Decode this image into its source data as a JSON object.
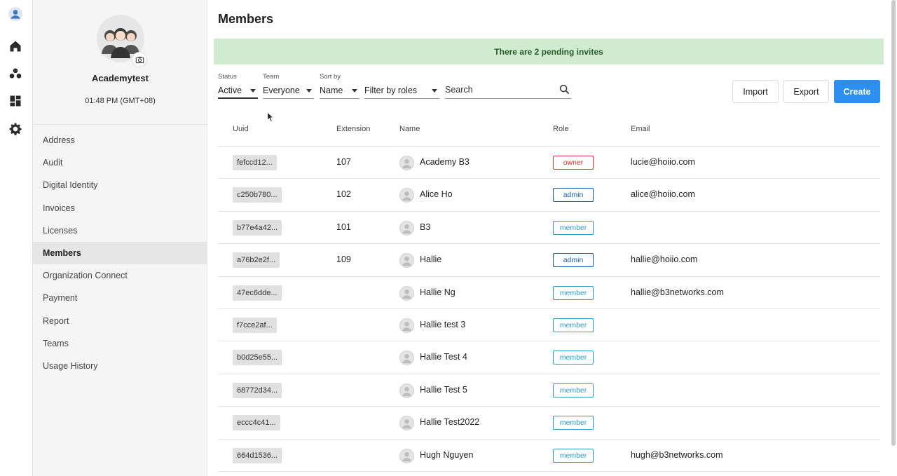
{
  "rail": {
    "icons": [
      "user-avatar-icon",
      "home-icon",
      "team-icon",
      "dashboard-icon",
      "gear-icon"
    ]
  },
  "org": {
    "name": "Academytest",
    "time": "01:48 PM (GMT+08)"
  },
  "sidebar": {
    "items": [
      {
        "label": "Address"
      },
      {
        "label": "Audit"
      },
      {
        "label": "Digital Identity"
      },
      {
        "label": "Invoices"
      },
      {
        "label": "Licenses"
      },
      {
        "label": "Members",
        "active": true
      },
      {
        "label": "Organization Connect"
      },
      {
        "label": "Payment"
      },
      {
        "label": "Report"
      },
      {
        "label": "Teams"
      },
      {
        "label": "Usage History"
      }
    ]
  },
  "page": {
    "title": "Members",
    "banner": "There are 2 pending invites"
  },
  "filters": {
    "status": {
      "label": "Status",
      "value": "Active"
    },
    "team": {
      "label": "Team",
      "value": "Everyone"
    },
    "sort": {
      "label": "Sort by",
      "value": "Name"
    },
    "roles": {
      "value": "Filter by roles"
    },
    "search": {
      "placeholder": "Search"
    }
  },
  "actions": {
    "import": "Import",
    "export": "Export",
    "create": "Create"
  },
  "table": {
    "headers": {
      "uuid": "Uuid",
      "extension": "Extension",
      "name": "Name",
      "role": "Role",
      "email": "Email"
    },
    "rows": [
      {
        "uuid": "fefccd12...",
        "extension": "107",
        "name": "Academy B3",
        "role": "owner",
        "email": "lucie@hoiio.com"
      },
      {
        "uuid": "c250b780...",
        "extension": "102",
        "name": "Alice Ho",
        "role": "admin",
        "email": "alice@hoiio.com"
      },
      {
        "uuid": "b77e4a42...",
        "extension": "101",
        "name": "B3",
        "role": "member",
        "email": ""
      },
      {
        "uuid": "a76b2e2f...",
        "extension": "109",
        "name": "Hallie",
        "role": "admin",
        "email": "hallie@hoiio.com"
      },
      {
        "uuid": "47ec6dde...",
        "extension": "",
        "name": "Hallie Ng",
        "role": "member",
        "email": "hallie@b3networks.com"
      },
      {
        "uuid": "f7cce2af...",
        "extension": "",
        "name": "Hallie test 3",
        "role": "member",
        "email": ""
      },
      {
        "uuid": "b0d25e55...",
        "extension": "",
        "name": "Hallie Test 4",
        "role": "member",
        "email": ""
      },
      {
        "uuid": "68772d34...",
        "extension": "",
        "name": "Hallie Test 5",
        "role": "member",
        "email": ""
      },
      {
        "uuid": "eccc4c41...",
        "extension": "",
        "name": "Hallie Test2022",
        "role": "member",
        "email": ""
      },
      {
        "uuid": "664d1536...",
        "extension": "",
        "name": "Hugh Nguyen",
        "role": "member",
        "email": "hugh@b3networks.com"
      }
    ]
  },
  "colors": {
    "primary": "#2b8ff0",
    "banner_bg": "#cfeccf",
    "owner": "#dd3333",
    "admin": "#1a5fa8",
    "member": "#2a9ec8"
  }
}
